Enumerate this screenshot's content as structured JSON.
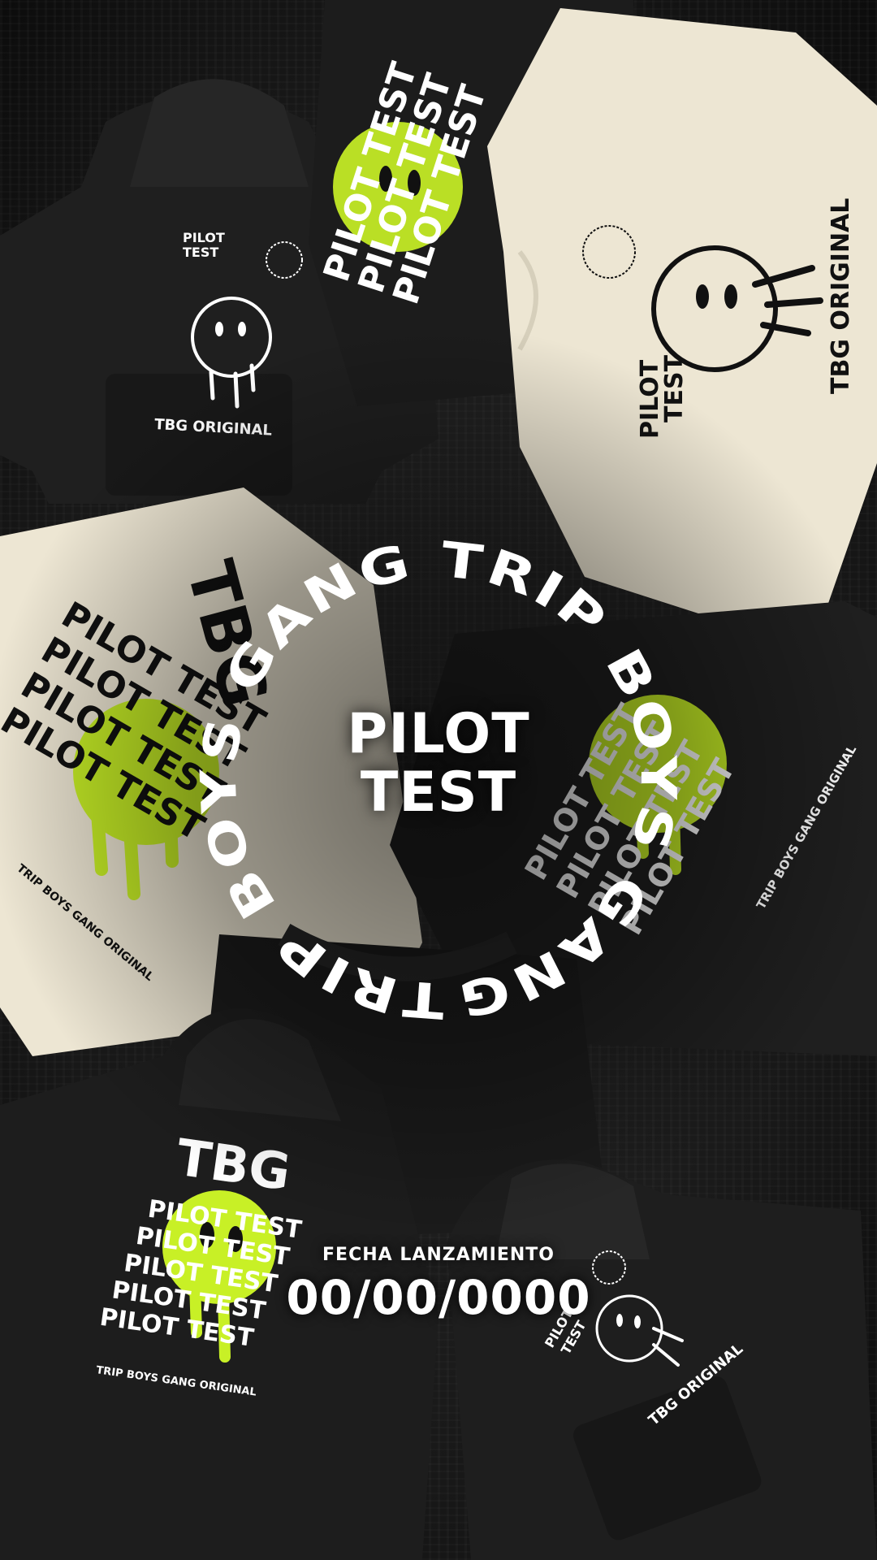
{
  "ring": {
    "text": "TRIP BOYS GANG TRIP BOYS GANG "
  },
  "center": {
    "line1": "PILOT",
    "line2": "TEST"
  },
  "launch": {
    "label": "FECHA LANZAMIENTO",
    "date": "00/00/0000"
  },
  "prints": {
    "pilot": "PILOT",
    "test": "TEST",
    "pilot_test": "PILOT TEST",
    "tbg": "TBG",
    "tbg_original": "TBG ORIGINAL",
    "trip_boys_gang_original": "TRIP BOYS GANG ORIGINAL",
    "tiny_ring": "TRIP BOYS GANG · TRIP BOYS GANG ·"
  },
  "colors": {
    "background": "#141414",
    "garment_black": "#1e1e1e",
    "garment_cream": "#ede6d3",
    "neon": "#c8f026",
    "text": "#ffffff"
  }
}
